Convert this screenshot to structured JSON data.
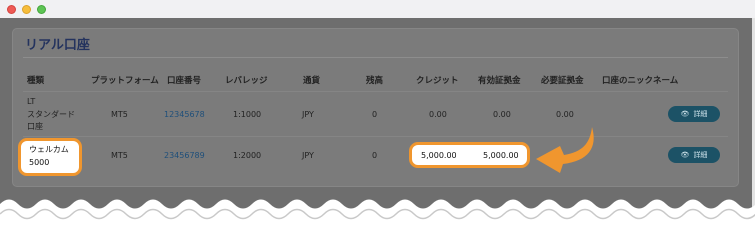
{
  "card": {
    "title": "リアル口座"
  },
  "columns": [
    "種類",
    "プラットフォーム",
    "口座番号",
    "レバレッジ",
    "通貨",
    "残高",
    "クレジット",
    "有効証拠金",
    "必要証拠金",
    "口座のニックネーム"
  ],
  "rows": [
    {
      "type_lines": [
        "LT",
        "スタンダード",
        "口座"
      ],
      "platform": "MT5",
      "account_number": "12345678",
      "leverage": "1:1000",
      "currency": "JPY",
      "balance": "0",
      "credit": "0.00",
      "equity": "0.00",
      "required_margin": "0.00",
      "nickname": "",
      "details_label": "詳細"
    },
    {
      "type_lines": [
        "ウェルカム",
        "5000"
      ],
      "platform": "MT5",
      "account_number": "23456789",
      "leverage": "1:2000",
      "currency": "JPY",
      "balance": "0",
      "credit": "5,000.00",
      "equity": "5,000.00",
      "required_margin": "",
      "nickname": "",
      "details_label": "詳細"
    }
  ],
  "icons": {
    "details": "eye-icon",
    "pointer": "orange-arrow-icon"
  },
  "colors": {
    "highlight": "#f0962e",
    "button": "#1c5266",
    "title": "#24335e",
    "link": "#1f4f7a"
  }
}
